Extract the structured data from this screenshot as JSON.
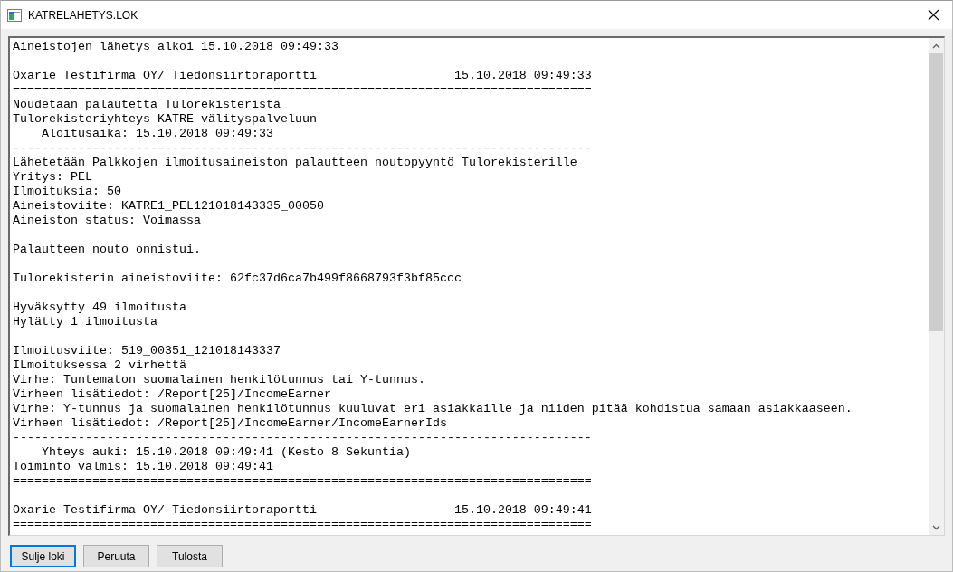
{
  "window": {
    "title": "KATRELAHETYS.LOK"
  },
  "log": {
    "paragraphs": [
      [
        "Aineistojen lähetys alkoi 15.10.2018 09:49:33"
      ],
      [
        "Oxarie Testifirma OY/ Tiedonsiirtoraportti                   15.10.2018 09:49:33",
        "================================================================================",
        "Noudetaan palautetta Tulorekisteristä",
        "Tulorekisteriyhteys KATRE välityspalveluun",
        "    Aloitusaika: 15.10.2018 09:49:33",
        "--------------------------------------------------------------------------------",
        "Lähetetään Palkkojen ilmoitusaineiston palautteen noutopyyntö Tulorekisterille",
        "Yritys: PEL",
        "Ilmoituksia: 50",
        "Aineistoviite: KATRE1_PEL121018143335_00050",
        "Aineiston status: Voimassa"
      ],
      [
        "Palautteen nouto onnistui."
      ],
      [
        "Tulorekisterin aineistoviite: 62fc37d6ca7b499f8668793f3bf85ccc"
      ],
      [
        "Hyväksytty 49 ilmoitusta",
        "Hylätty 1 ilmoitusta"
      ],
      [
        "Ilmoitusviite: 519_00351_121018143337",
        "ILmoituksessa 2 virhettä",
        "Virhe: Tuntematon suomalainen henkilötunnus tai Y-tunnus.",
        "Virheen lisätiedot: /Report[25]/IncomeEarner",
        "Virhe: Y-tunnus ja suomalainen henkilötunnus kuuluvat eri asiakkaille ja niiden pitää kohdistua samaan asiakkaaseen.",
        "Virheen lisätiedot: /Report[25]/IncomeEarner/IncomeEarnerIds",
        "--------------------------------------------------------------------------------",
        "    Yhteys auki: 15.10.2018 09:49:41 (Kesto 8 Sekuntia)",
        "Toiminto valmis: 15.10.2018 09:49:41",
        "================================================================================"
      ],
      [
        "Oxarie Testifirma OY/ Tiedonsiirtoraportti                   15.10.2018 09:49:41",
        "================================================================================"
      ]
    ]
  },
  "buttons": [
    {
      "label": "Sulje loki",
      "focused": true
    },
    {
      "label": "Peruuta",
      "focused": false
    },
    {
      "label": "Tulosta",
      "focused": false
    }
  ]
}
